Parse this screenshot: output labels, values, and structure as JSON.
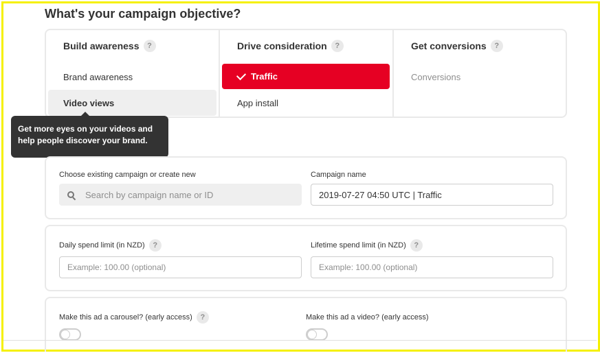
{
  "page_title": "What's your campaign objective?",
  "objectives": {
    "columns": [
      {
        "heading": "Build awareness",
        "help": "?",
        "options": [
          "Brand awareness",
          "Video views"
        ]
      },
      {
        "heading": "Drive consideration",
        "help": "?",
        "options": [
          "Traffic",
          "App install"
        ]
      },
      {
        "heading": "Get conversions",
        "help": "?",
        "options": [
          "Conversions"
        ]
      }
    ],
    "selected": "Traffic",
    "hovered": "Video views",
    "disabled": [
      "Conversions"
    ]
  },
  "tooltip": {
    "line1": "Get more eyes on your videos and",
    "line2": "help people discover your brand."
  },
  "campaign": {
    "existing_label": "Choose existing campaign or create new",
    "search_placeholder": "Search by campaign name or ID",
    "name_label": "Campaign name",
    "name_value": "2019-07-27 04:50 UTC | Traffic"
  },
  "budget": {
    "daily_label": "Daily spend limit (in NZD)",
    "daily_help": "?",
    "daily_placeholder": "Example: 100.00 (optional)",
    "lifetime_label": "Lifetime spend limit (in NZD)",
    "lifetime_help": "?",
    "lifetime_placeholder": "Example: 100.00 (optional)"
  },
  "ad_format": {
    "carousel_label": "Make this ad a carousel? (early access)",
    "carousel_help": "?",
    "carousel_on": false,
    "video_label": "Make this ad a video? (early access)",
    "video_on": false
  },
  "colors": {
    "accent": "#e60023",
    "frame": "#f5f000",
    "tooltip_bg": "#333333"
  }
}
